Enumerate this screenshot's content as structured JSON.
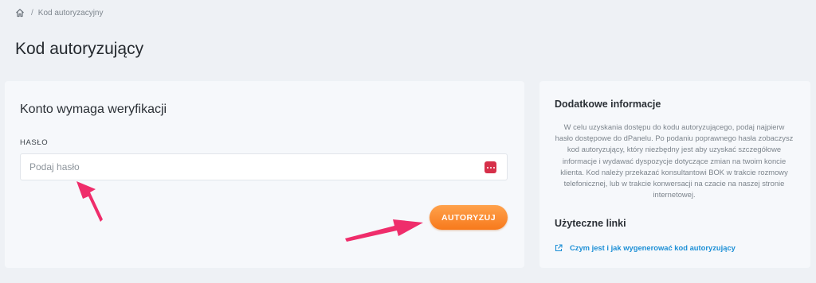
{
  "breadcrumb": {
    "home_icon": "home-icon",
    "separator": "/",
    "current": "Kod autoryzacyjny"
  },
  "page": {
    "title": "Kod autoryzujący"
  },
  "verification": {
    "heading": "Konto wymaga weryfikacji",
    "password_label": "HASŁO",
    "password_placeholder": "Podaj hasło",
    "password_value": "",
    "password_manager_icon": "password-manager-icon",
    "submit_label": "AUTORYZUJ"
  },
  "sidebar": {
    "info_heading": "Dodatkowe informacje",
    "info_text": "W celu uzyskania dostępu do kodu autoryzującego, podaj najpierw hasło dostępowe do dPanelu. Po podaniu poprawnego hasła zobaczysz kod autoryzujący, który niezbędny jest aby uzyskać szczegółowe informacje i wydawać dyspozycje dotyczące zmian na twoim koncie klienta. Kod należy przekazać konsultantowi BOK w trakcie rozmowy telefonicznej, lub w trakcie konwersacji na czacie na naszej stronie internetowej.",
    "links_heading": "Użyteczne linki",
    "link_icon": "external-link-icon",
    "link_text": "Czym jest i jak wygenerować kod autoryzujący"
  },
  "colors": {
    "accent": "#f7791c",
    "link": "#1c8fd6",
    "annotation_arrow": "#ef2d6b",
    "background": "#eef1f5",
    "card": "#f6f8fb"
  }
}
